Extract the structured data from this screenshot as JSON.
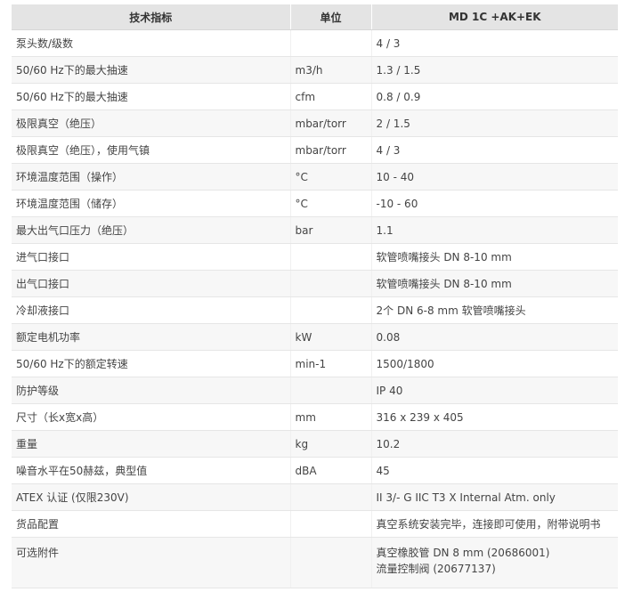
{
  "header": {
    "col_param": "技术指标",
    "col_unit": "单位",
    "col_value": "MD 1C +AK+EK"
  },
  "rows": [
    {
      "param": "泵头数/级数",
      "unit": "",
      "value": "4 / 3"
    },
    {
      "param": "50/60 Hz下的最大抽速",
      "unit": "m3/h",
      "value": "1.3 / 1.5"
    },
    {
      "param": "50/60 Hz下的最大抽速",
      "unit": "cfm",
      "value": "0.8 / 0.9"
    },
    {
      "param": "极限真空（绝压）",
      "unit": "mbar/torr",
      "value": "2 / 1.5"
    },
    {
      "param": "极限真空（绝压），使用气镇",
      "unit": "mbar/torr",
      "value": "4 / 3"
    },
    {
      "param": "环境温度范围（操作）",
      "unit": "°C",
      "value": "10 - 40"
    },
    {
      "param": "环境温度范围（储存）",
      "unit": "°C",
      "value": "-10 - 60"
    },
    {
      "param": "最大出气口压力（绝压）",
      "unit": "bar",
      "value": "1.1"
    },
    {
      "param": "进气口接口",
      "unit": "",
      "value": "软管喷嘴接头 DN 8-10 mm"
    },
    {
      "param": "出气口接口",
      "unit": "",
      "value": "软管喷嘴接头 DN 8-10 mm"
    },
    {
      "param": "冷却液接口",
      "unit": "",
      "value": "2个 DN 6-8 mm 软管喷嘴接头"
    },
    {
      "param": "额定电机功率",
      "unit": "kW",
      "value": "0.08"
    },
    {
      "param": "50/60 Hz下的额定转速",
      "unit": "min-1",
      "value": "1500/1800"
    },
    {
      "param": "防护等级",
      "unit": "",
      "value": "IP 40"
    },
    {
      "param": "尺寸（长x宽x高）",
      "unit": "mm",
      "value": "316 x 239 x 405"
    },
    {
      "param": "重量",
      "unit": "kg",
      "value": "10.2"
    },
    {
      "param": "噪音水平在50赫兹，典型值",
      "unit": "dBA",
      "value": "45"
    },
    {
      "param": "ATEX 认证 (仅限230V)",
      "unit": "",
      "value": "II 3/- G IIC T3 X Internal Atm. only"
    },
    {
      "param": "货品配置",
      "unit": "",
      "value": "真空系统安装完毕，连接即可使用，附带说明书"
    }
  ],
  "last_row": {
    "param": "可选附件",
    "unit": "",
    "value_lines": [
      "真空橡胶管 DN 8 mm (20686001)",
      "流量控制阀 (20677137)"
    ]
  }
}
